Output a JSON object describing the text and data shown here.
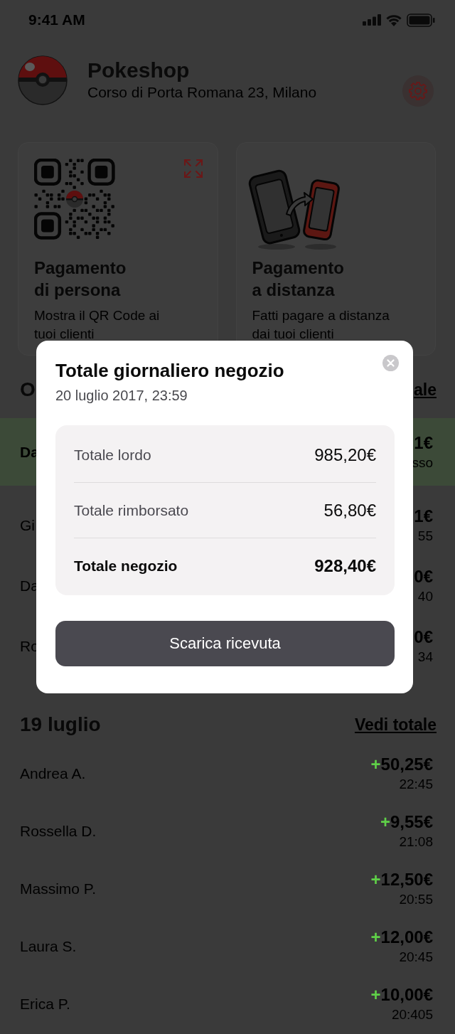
{
  "status_bar": {
    "time": "9:41 AM"
  },
  "shop": {
    "name": "Pokeshop",
    "address": "Corso di Porta Romana 23, Milano"
  },
  "cards": [
    {
      "kind": "qr",
      "title": "Pagamento\ndi persona",
      "description": "Mostra il QR Code ai\ntuoi clienti"
    },
    {
      "kind": "remote",
      "title": "Pagamento\na distanza",
      "description": "Fatti pagare a distanza\ndai tuoi clienti"
    }
  ],
  "sections": [
    {
      "title": "O",
      "link": "ale",
      "rows": [
        {
          "name": "Da",
          "amount": "1€",
          "sub": "sso",
          "highlighted": true
        },
        {
          "name": "Gi",
          "amount": "1€",
          "sub": "55",
          "highlighted": false
        },
        {
          "name": "Da",
          "amount": "0€",
          "sub": "40",
          "highlighted": false
        },
        {
          "name": "Ro",
          "amount": "0€",
          "sub": "34",
          "highlighted": false
        }
      ]
    },
    {
      "title": "19 luglio",
      "link": "Vedi totale",
      "rows": [
        {
          "name": "Andrea A.",
          "sign": "+",
          "amount": "50,25€",
          "sub": "22:45",
          "highlighted": false
        },
        {
          "name": "Rossella D.",
          "sign": "+",
          "amount": "9,55€",
          "sub": "21:08",
          "highlighted": false
        },
        {
          "name": "Massimo P.",
          "sign": "+",
          "amount": "12,50€",
          "sub": "20:55",
          "highlighted": false
        },
        {
          "name": "Laura S.",
          "sign": "+",
          "amount": "12,00€",
          "sub": "20:45",
          "highlighted": false
        },
        {
          "name": "Erica P.",
          "sign": "+",
          "amount": "10,00€",
          "sub": "20:405",
          "highlighted": false
        }
      ]
    }
  ],
  "modal": {
    "title": "Totale giornaliero negozio",
    "date": "20 luglio 2017, 23:59",
    "lines": [
      {
        "kind": "item",
        "label": "Totale lordo",
        "value": "985,20€"
      },
      {
        "kind": "item",
        "label": "Totale rimborsato",
        "value": "56,80€"
      },
      {
        "kind": "total",
        "label": "Totale negozio",
        "value": "928,40€"
      }
    ],
    "button": "Scarica ricevuta"
  }
}
